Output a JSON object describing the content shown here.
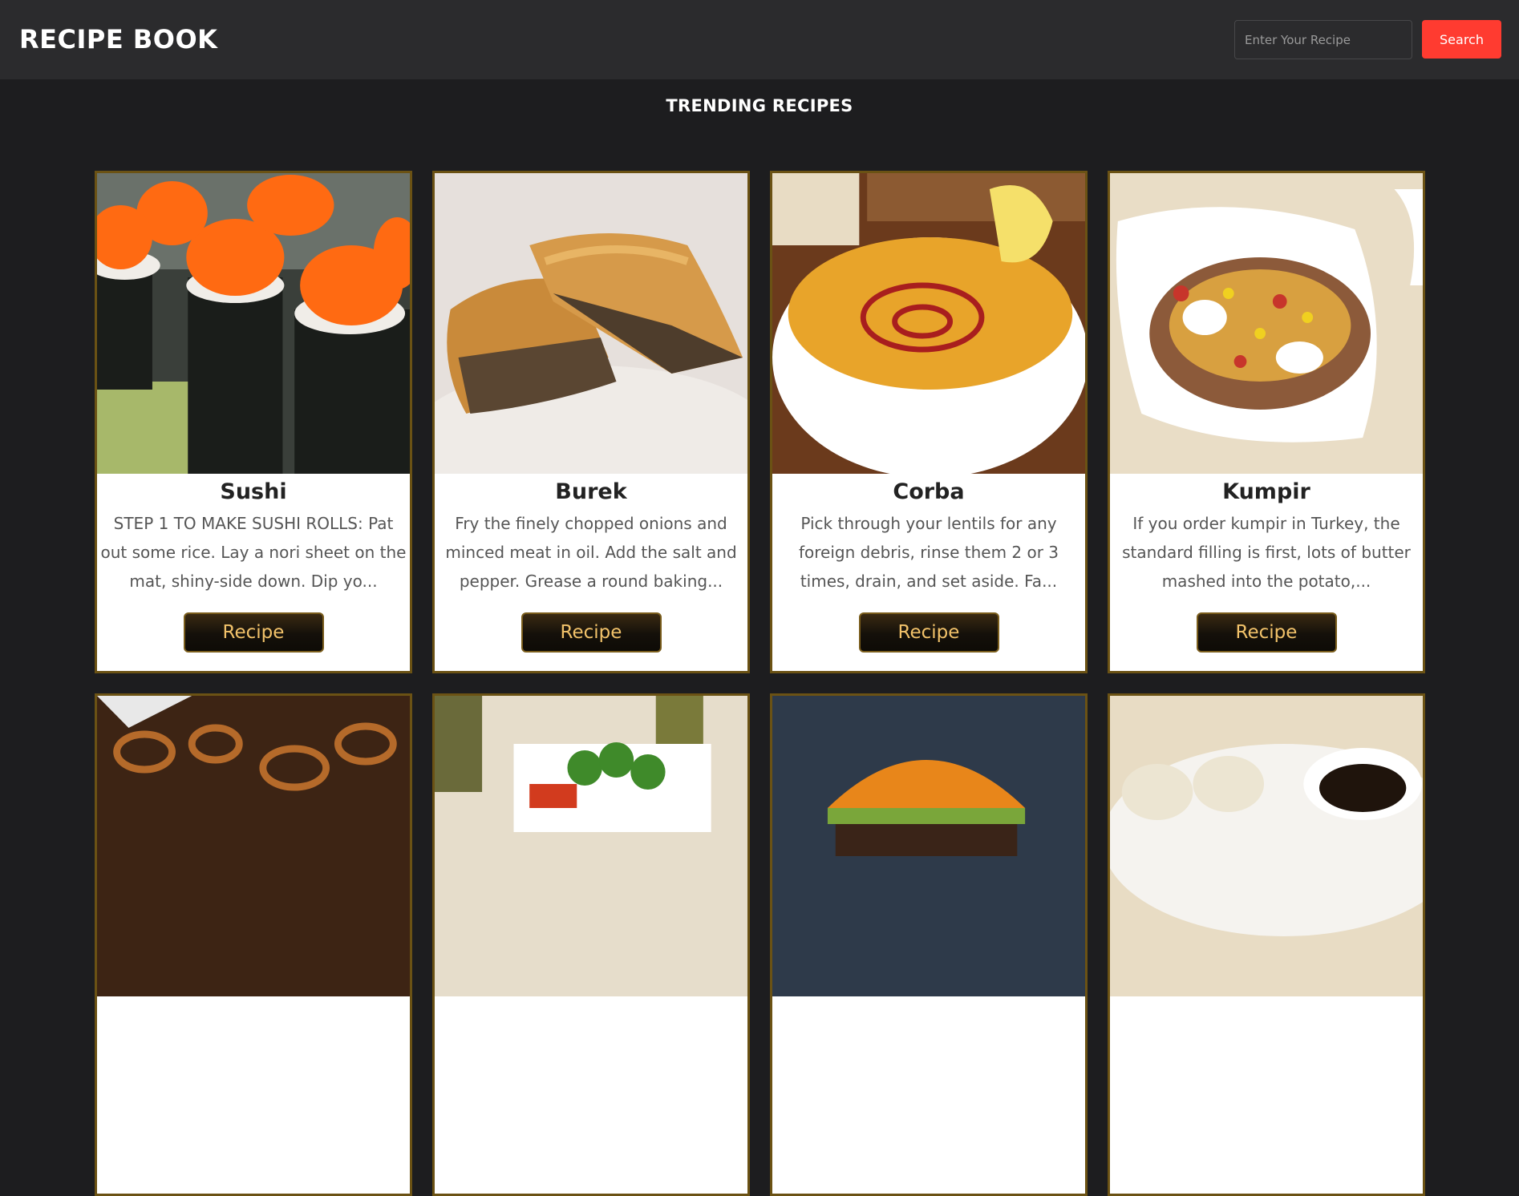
{
  "header": {
    "title": "RECIPE BOOK",
    "search_placeholder": "Enter Your Recipe",
    "search_button": "Search"
  },
  "section": {
    "title": "TRENDING RECIPES"
  },
  "recipes": [
    {
      "name": "Sushi",
      "description": "STEP 1 TO MAKE SUSHI ROLLS: Pat out some rice. Lay a nori sheet on the mat, shiny-side down. Dip yo...",
      "button": "Recipe"
    },
    {
      "name": "Burek",
      "description": "Fry the finely chopped onions and minced meat in oil. Add the salt and pepper. Grease a round baking...",
      "button": "Recipe"
    },
    {
      "name": "Corba",
      "description": "Pick through your lentils for any foreign debris, rinse them 2 or 3 times, drain, and set aside. Fa...",
      "button": "Recipe"
    },
    {
      "name": "Kumpir",
      "description": "If you order kumpir in Turkey, the standard filling is first, lots of butter mashed into the potato,...",
      "button": "Recipe"
    }
  ],
  "colors": {
    "accent": "#ff3b30",
    "card_border": "#6b5214",
    "button_text": "#f2c26a"
  }
}
